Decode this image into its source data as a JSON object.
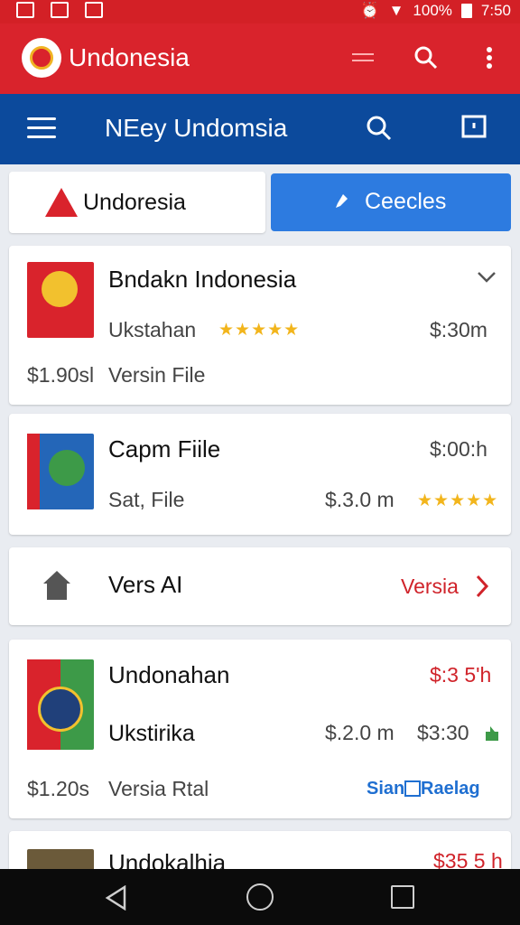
{
  "status_bar": {
    "battery": "100%",
    "time": "7:50"
  },
  "app_bar": {
    "title": "Undonesia"
  },
  "toolbar": {
    "title": "NEey Undomsia"
  },
  "tabs": [
    {
      "label": "Undoresia"
    },
    {
      "label": "Ceecles"
    }
  ],
  "cards": [
    {
      "title": "Bndakn Indonesia",
      "subtitle": "Ukstahan",
      "right_value": "$:30m",
      "left_value": "$1.90sl",
      "meta": "Versin File",
      "rating_stars": 5
    },
    {
      "title": "Capm Fiile",
      "right_value": "$:00:h",
      "subtitle": "Sat, File",
      "price": "$.3.0 m",
      "rating_stars": 5
    },
    {
      "title": "Vers AI",
      "link_label": "Versia"
    },
    {
      "title": "Undonahan",
      "right_value": "$:3 5'h",
      "subtitle": "Ukstirika",
      "price": "$.2.0 m",
      "price2": "$3:30",
      "left_value": "$1.20s",
      "meta": "Versia Rtal",
      "link_label": "Sian",
      "link_label2": "Raelag"
    },
    {
      "title": "Undokalhia",
      "right_value": "$35 5 h"
    }
  ],
  "colors": {
    "brand_red": "#d9232c",
    "toolbar_blue": "#0c4a9c",
    "tab_blue": "#2d7be0",
    "star_gold": "#f2b51c",
    "link_red": "#d0232a",
    "link_blue": "#1f6fd1"
  }
}
